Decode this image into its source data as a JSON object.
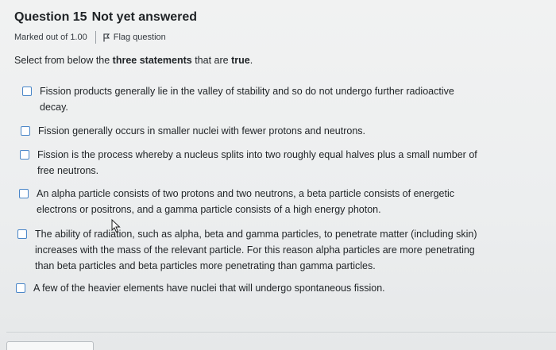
{
  "question": {
    "label": "Question 15",
    "status": "Not yet answered",
    "marked": "Marked out of 1.00",
    "flag_label": "Flag question"
  },
  "prompt": {
    "before": "Select from below the ",
    "bold": "three statements",
    "after": " that are ",
    "bold2": "true",
    "end": "."
  },
  "options": [
    "Fission products generally lie in the valley of stability and so do not undergo further radioactive decay.",
    "Fission generally occurs in smaller nuclei with fewer protons and neutrons.",
    "Fission is the process whereby a nucleus splits into two roughly equal halves plus a small number of free neutrons.",
    "An alpha particle consists of two protons and two neutrons, a beta particle consists of energetic electrons or positrons, and a gamma particle consists of a high energy photon.",
    "The ability of radiation, such as alpha, beta and gamma particles, to penetrate matter (including skin) increases with the mass of the relevant particle.  For this reason alpha particles are more penetrating than beta particles and beta particles more penetrating than gamma particles.",
    "A few of the heavier elements have nuclei that will undergo spontaneous fission."
  ],
  "colors": {
    "checkbox_border": "#4a86c8",
    "text": "#1f2326"
  }
}
